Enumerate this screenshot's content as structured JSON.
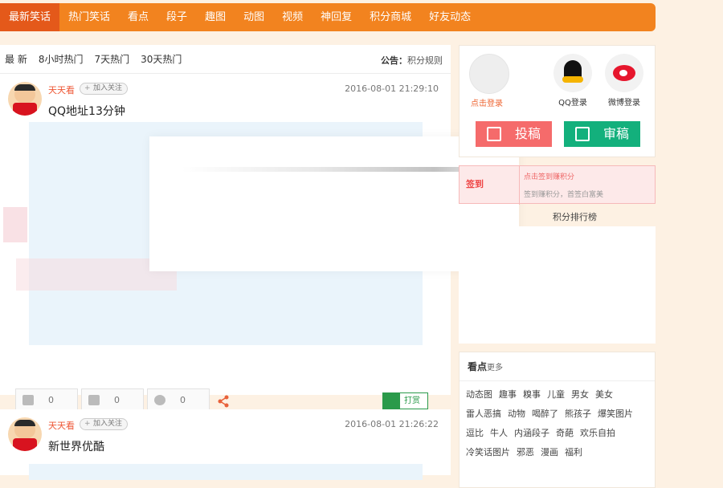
{
  "nav": {
    "items": [
      {
        "label": "最新笑话",
        "active": true
      },
      {
        "label": "热门笑话"
      },
      {
        "label": "看点"
      },
      {
        "label": "段子"
      },
      {
        "label": "趣图"
      },
      {
        "label": "动图"
      },
      {
        "label": "视频"
      },
      {
        "label": "神回复"
      },
      {
        "label": "积分商城"
      },
      {
        "label": "好友动态"
      }
    ]
  },
  "filters": [
    "最 新",
    "8小时热门",
    "7天热门",
    "30天热门"
  ],
  "notice": {
    "label": "公告：",
    "text": "积分规则"
  },
  "posts": [
    {
      "author": "天天看",
      "follow_label": "加入关注",
      "time": "2016-08-01 21:29:10",
      "title": "QQ地址13分钟",
      "likes": "0",
      "dislikes": "0",
      "comments": "0",
      "tip_label": "打赏"
    },
    {
      "author": "天天看",
      "follow_label": "加入关注",
      "time": "2016-08-01 21:26:22",
      "title": "新世界优酷"
    }
  ],
  "login": {
    "click_login": "点击登录",
    "qq_label": "QQ登录",
    "weibo_label": "微博登录",
    "submit_label": "投稿",
    "review_label": "审稿"
  },
  "signin": {
    "label": "签到",
    "hint1": "点击签到赚积分",
    "hint2": "签到赚积分，首签白富美"
  },
  "rank_title": "积分排行榜",
  "tags_section": {
    "title": "看点",
    "more": "更多",
    "tags": [
      "动态图",
      "趣事",
      "糗事",
      "儿童",
      "男女",
      "美女",
      "雷人恶搞",
      "动物",
      "喝醉了",
      "熊孩子",
      "爆笑图片",
      "逗比",
      "牛人",
      "内涵段子",
      "奇葩",
      "欢乐自拍",
      "冷笑话图片",
      "邪恶",
      "漫画",
      "福利"
    ]
  },
  "colors": {
    "nav_bg": "#f2831f",
    "nav_active": "#e4591a",
    "page_bg": "#fdf1e3",
    "submit_btn": "#f56b6b",
    "review_btn": "#13b07c"
  }
}
